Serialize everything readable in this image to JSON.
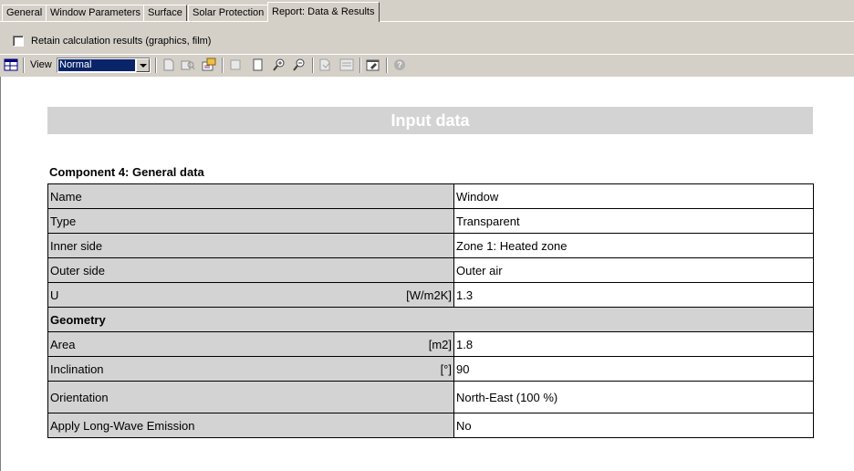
{
  "tabs": [
    {
      "label": "General"
    },
    {
      "label": "Window Parameters"
    },
    {
      "label": "Surface"
    },
    {
      "label": "Solar Protection"
    },
    {
      "label": "Report: Data & Results",
      "active": true
    }
  ],
  "options": {
    "retain_label": "Retain calculation results (graphics, film)",
    "retain_checked": false
  },
  "toolbar": {
    "view_label": "View",
    "view_value": "Normal",
    "icons": [
      "layout-icon",
      "page-icon",
      "print-preview-icon",
      "export-icon",
      "blank-page-icon",
      "single-page-icon",
      "zoom-in-icon",
      "zoom-out-icon",
      "print-icon",
      "print-setup-icon",
      "edit-icon",
      "help-icon"
    ]
  },
  "report": {
    "banner": "Input data",
    "section_title": "Component 4: General data",
    "rows": [
      {
        "label": "Name",
        "unit": "",
        "value": "Window"
      },
      {
        "label": "Type",
        "unit": "",
        "value": "Transparent"
      },
      {
        "label": "Inner side",
        "unit": "",
        "value": "Zone 1: Heated zone"
      },
      {
        "label": "Outer side",
        "unit": "",
        "value": "Outer air"
      },
      {
        "label": "U",
        "unit": "[W/m2K]",
        "value": "1.3"
      }
    ],
    "group_label": "Geometry",
    "geometry_rows": [
      {
        "label": "Area",
        "unit": "[m2]",
        "value": "1.8"
      },
      {
        "label": "Inclination",
        "unit": "[°]",
        "value": "90"
      },
      {
        "label": "Orientation",
        "unit": "",
        "value": "North-East (100 %)"
      },
      {
        "label": "Apply Long-Wave Emission",
        "unit": "",
        "value": "No"
      }
    ]
  }
}
